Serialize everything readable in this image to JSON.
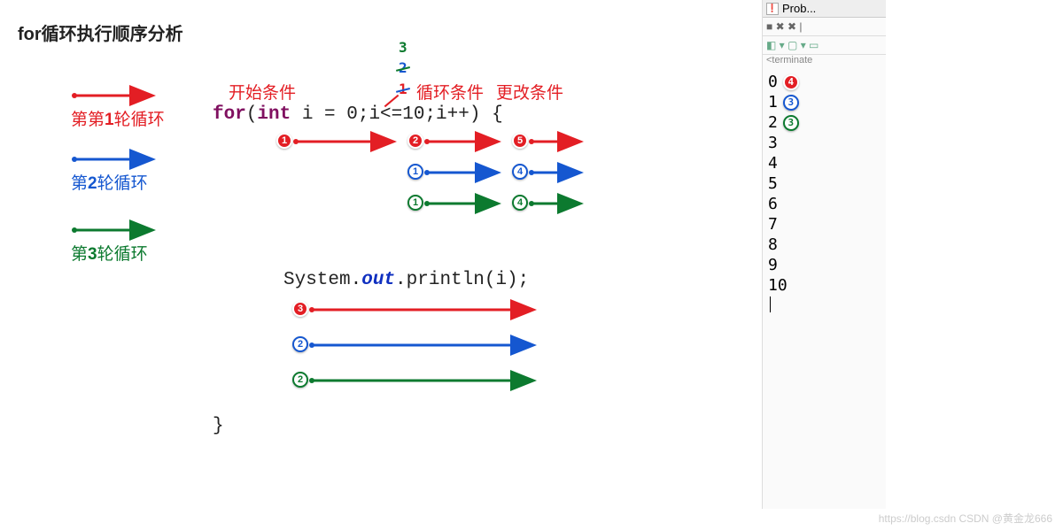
{
  "title": "for循环执行顺序分析",
  "legend": [
    {
      "label": "第1轮循环",
      "color": "#e31e24"
    },
    {
      "label": "第2轮循环",
      "color": "#1557d0"
    },
    {
      "label": "第3轮循环",
      "color": "#0c7a2f"
    }
  ],
  "annotations": {
    "start_condition": "开始条件",
    "loop_condition": "循环条件",
    "update_condition": "更改条件",
    "iteration_1": "1",
    "iteration_2": "2",
    "iteration_3": "3"
  },
  "code": {
    "for_kw": "for",
    "int_kw": "int",
    "decl": " i = 0;i<=10;i++) {",
    "open": "(",
    "print_pre": "System.",
    "out": "out",
    "print_post": ".println(i);",
    "close": "}"
  },
  "badges": {
    "row1": [
      1,
      2,
      5
    ],
    "row2": [
      1,
      4
    ],
    "row3": [
      1,
      4
    ],
    "println": [
      3,
      2,
      2
    ]
  },
  "console": {
    "tab_label": "Prob...",
    "toolbar_icons": "■ ✖ ✖ |",
    "toolbar_icons2": "◧ ▾ ▢ ▾ ▭",
    "status": "<terminate",
    "rows": [
      {
        "value": "0",
        "badge": 4,
        "cls": "red-b"
      },
      {
        "value": "1",
        "badge": 3,
        "cls": "blue-b"
      },
      {
        "value": "2",
        "badge": 3,
        "cls": "green-b"
      },
      {
        "value": "3"
      },
      {
        "value": "4"
      },
      {
        "value": "5"
      },
      {
        "value": "6"
      },
      {
        "value": "7"
      },
      {
        "value": "8"
      },
      {
        "value": "9"
      },
      {
        "value": "10"
      }
    ]
  },
  "watermark": "https://blog.csdn CSDN @黄金龙666",
  "colors": {
    "red": "#e31e24",
    "blue": "#1557d0",
    "green": "#0c7a2f"
  }
}
